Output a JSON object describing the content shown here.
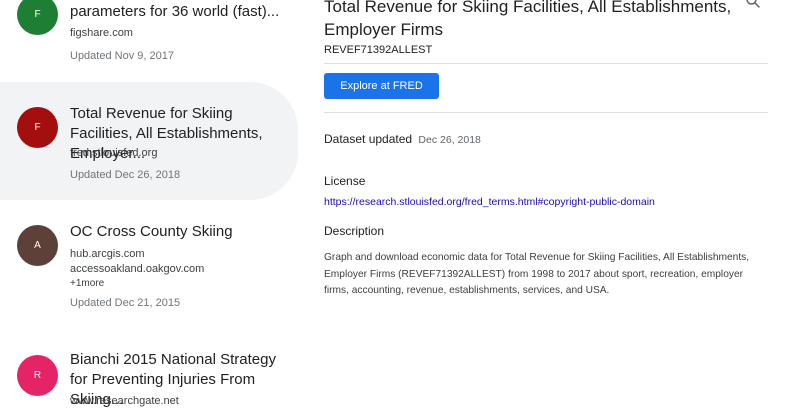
{
  "results": [
    {
      "avatar_letter": "F",
      "avatar_color": "#1e7e34",
      "title": "parameters for 36 world (fast)...",
      "sources": [
        "figshare.com"
      ],
      "updated": "Updated Nov 9, 2017"
    },
    {
      "avatar_letter": "F",
      "avatar_color": "#a50e0e",
      "title": "Total Revenue for Skiing Facilities, All Establishments, Employer...",
      "sources": [
        "fred.stlouisfed.org"
      ],
      "updated": "Updated Dec 26, 2018",
      "selected": true
    },
    {
      "avatar_letter": "A",
      "avatar_color": "#5d4037",
      "title": "OC Cross County Skiing",
      "sources": [
        "hub.arcgis.com",
        "accessoakland.oakgov.com",
        "+1more"
      ],
      "updated": "Updated Dec 21, 2015"
    },
    {
      "avatar_letter": "R",
      "avatar_color": "#e52467",
      "title": "Bianchi 2015 National Strategy for Preventing Injuries From Skiing...",
      "sources": [
        "www.researchgate.net"
      ],
      "updated": ""
    }
  ],
  "detail": {
    "title": "Total Revenue for Skiing Facilities, All Establishments, Employer Firms",
    "code": "REVEF71392ALLEST",
    "explore_label": "Explore at FRED",
    "dataset_updated_label": "Dataset updated",
    "dataset_updated_value": "Dec 26, 2018",
    "license_label": "License",
    "license_link": "https://research.stlouisfed.org/fred_terms.html#copyright-public-domain",
    "description_label": "Description",
    "description_text": "Graph and download economic data for Total Revenue for Skiing Facilities, All Establishments, Employer Firms (REVEF71392ALLEST) from 1998 to 2017 about sport, recreation, employer firms, accounting, revenue, establishments, services, and USA."
  },
  "icons": {
    "search": "search-icon"
  },
  "colors": {
    "accent": "#1a73e8",
    "link": "#1a0dab",
    "selected_bg": "#f1f3f4"
  }
}
